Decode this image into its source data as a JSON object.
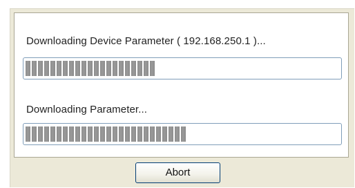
{
  "dialog": {
    "device_label": "Downloading Device Parameter ( 192.168.250.1 )...",
    "device_progress": 0.42,
    "parameter_label": "Downloading Parameter...",
    "parameter_progress": 0.52,
    "abort_label": "Abort"
  },
  "colors": {
    "progress_segment": "#8c8c8c",
    "progress_border": "#7f9db9",
    "dialog_background": "#ece9d8"
  }
}
